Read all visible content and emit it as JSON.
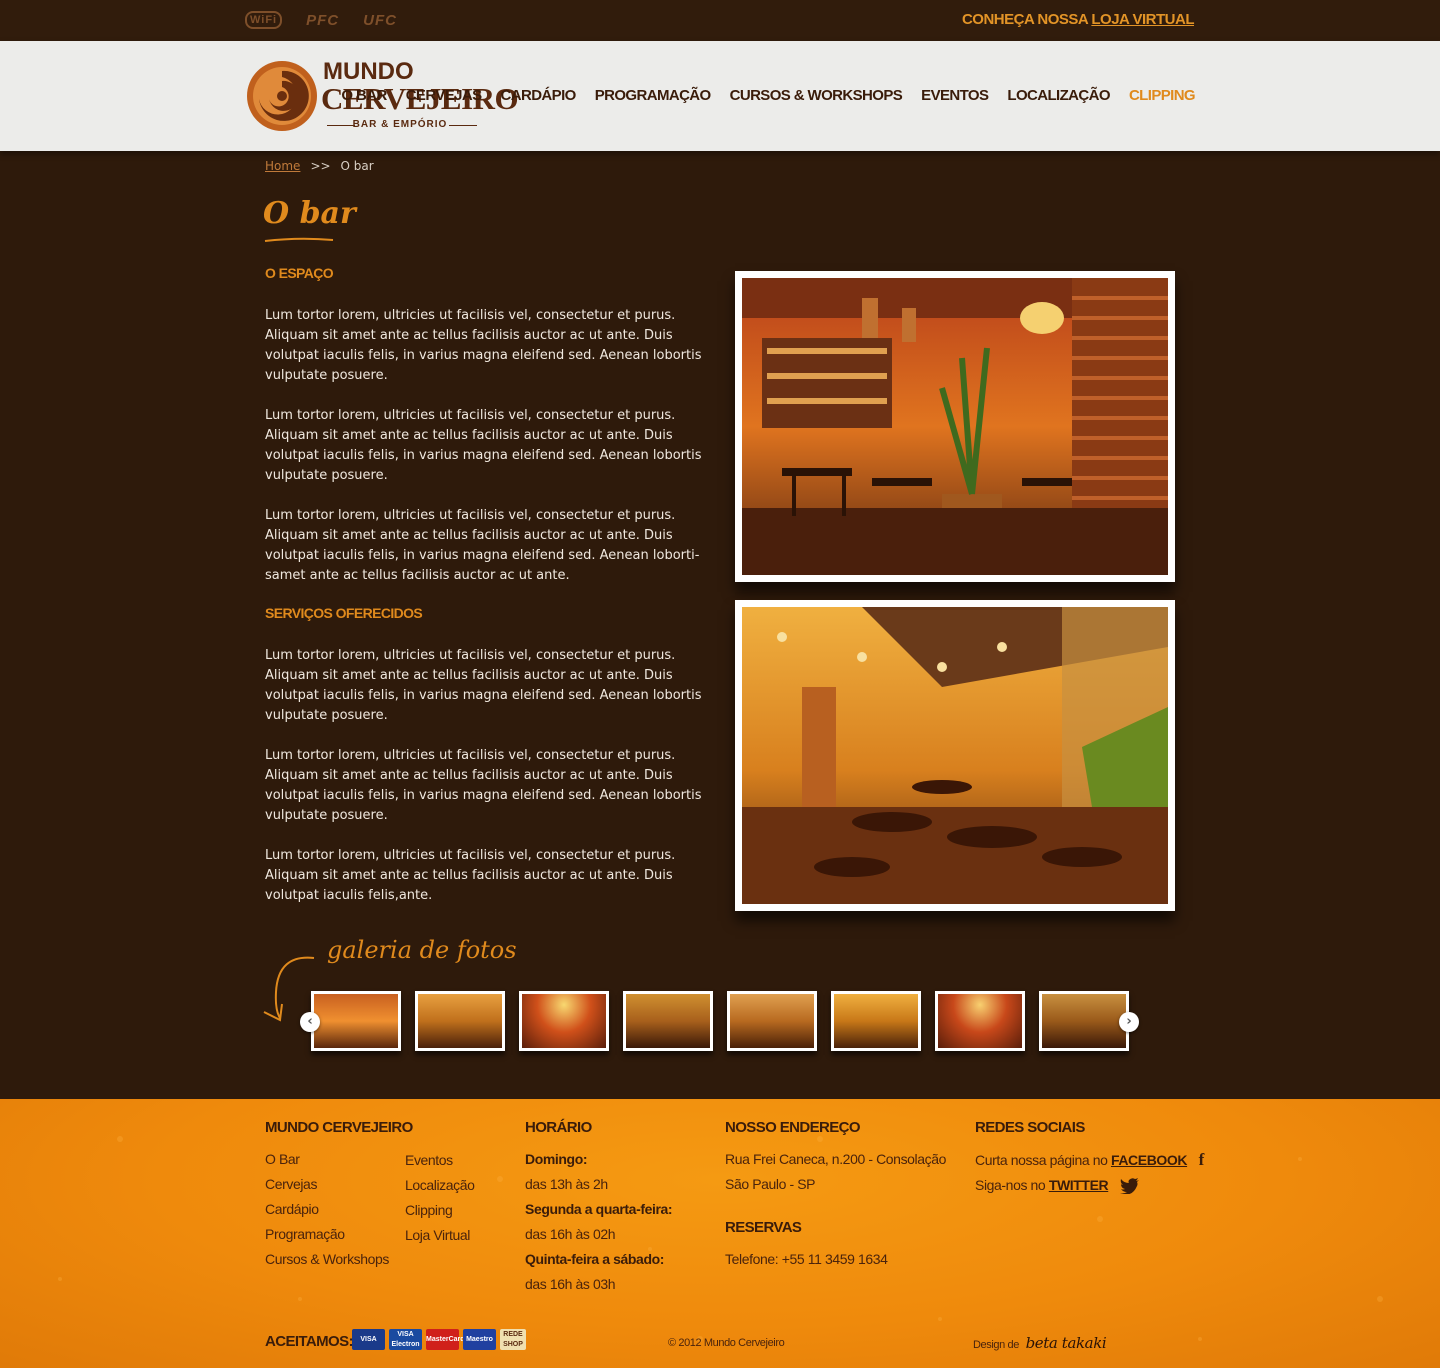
{
  "topbar": {
    "badges": [
      "WiFi",
      "PFC",
      "UFC"
    ],
    "store_prefix": "CONHEÇA NOSSA ",
    "store_link": "LOJA VIRTUAL"
  },
  "logo": {
    "line1": "MUNDO",
    "line2": "CERVEJEIRO",
    "line3": "BAR & EMPÓRIO"
  },
  "nav": [
    "O BAR",
    "CERVEJAS",
    "CARDÁPIO",
    "PROGRAMAÇÃO",
    "CURSOS & WORKSHOPS",
    "EVENTOS",
    "LOCALIZAÇÃO",
    "CLIPPING"
  ],
  "nav_active": "CLIPPING",
  "breadcrumb": {
    "home": "Home",
    "sep": ">>",
    "current": "O bar"
  },
  "page_title": "O bar",
  "sections": {
    "espaco_title": "O ESPAÇO",
    "servicos_title": "SERVIÇOS OFERECIDOS"
  },
  "paragraphs": [
    "Lum tortor lorem, ultricies ut facilisis vel, consectetur et purus. Aliquam sit amet ante ac tellus facilisis auctor ac ut ante. Duis volutpat iaculis felis, in varius magna eleifend sed. Aenean lobortis vulputate posuere.",
    "Lum tortor lorem, ultricies ut facilisis vel, consectetur et purus. Aliquam sit amet ante ac tellus facilisis auctor ac ut ante. Duis volutpat iaculis felis, in varius magna eleifend sed. Aenean lobortis vulputate posuere.",
    "Lum tortor lorem, ultricies ut facilisis vel, consectetur et purus. Aliquam sit amet ante ac tellus facilisis auctor ac ut ante. Duis volutpat iaculis felis, in varius magna eleifend sed. Aenean loborti-samet ante ac tellus facilisis auctor ac ut ante.",
    "Lum tortor lorem, ultricies ut facilisis vel, consectetur et purus. Aliquam sit amet ante ac tellus facilisis auctor ac ut ante. Duis volutpat iaculis felis, in varius magna eleifend sed. Aenean lobortis vulputate posuere.",
    "Lum tortor lorem, ultricies ut facilisis vel, consectetur et purus. Aliquam sit amet ante ac tellus facilisis auctor ac ut ante. Duis volutpat iaculis felis, in varius magna eleifend sed. Aenean lobortis vulputate posuere.",
    "Lum tortor lorem, ultricies ut facilisis vel, consectetur et purus. Aliquam sit amet ante ac tellus facilisis auctor ac ut ante. Duis volutpat iaculis felis,ante."
  ],
  "gallery": {
    "title": "galeria de fotos",
    "thumb_count": 8,
    "prev": "‹",
    "next": "›"
  },
  "footer": {
    "col1_title": "MUNDO CERVEJEIRO",
    "col1_links": [
      "O Bar",
      "Cervejas",
      "Cardápio",
      "Programação",
      "Cursos & Workshops"
    ],
    "col1b_links": [
      "Eventos",
      "Localização",
      "Clipping",
      "Loja Virtual"
    ],
    "hours_title": "HORÁRIO",
    "hours": [
      {
        "day": "Domingo:",
        "time": "das 13h às 2h"
      },
      {
        "day": "Segunda a quarta-feira:",
        "time": "das 16h às 02h"
      },
      {
        "day": "Quinta-feira a sábado:",
        "time": "das 16h às 03h"
      }
    ],
    "address_title": "NOSSO ENDEREÇO",
    "address_line1": "Rua Frei Caneca, n.200 - Consolação",
    "address_line2": "São Paulo - SP",
    "reservas_title": "RESERVAS",
    "phone": "Telefone: +55 11 3459 1634",
    "social_title": "REDES SOCIAIS",
    "facebook_prefix": "Curta nossa página no ",
    "facebook_link": "FACEBOOK",
    "twitter_prefix": "Siga-nos no ",
    "twitter_link": "TWITTER",
    "accept_label": "ACEITAMOS:",
    "cards": [
      "VISA",
      "VISA Electron",
      "MasterCard",
      "Maestro",
      "REDE SHOP"
    ],
    "copyright": "© 2012 Mundo Cervejeiro",
    "design_prefix": "Design de",
    "design_name": "beta takaki"
  },
  "colors": {
    "background": "#2e1a0b",
    "accent": "#e08a1d",
    "footer": "#ef8a0c",
    "header": "#ececea"
  }
}
